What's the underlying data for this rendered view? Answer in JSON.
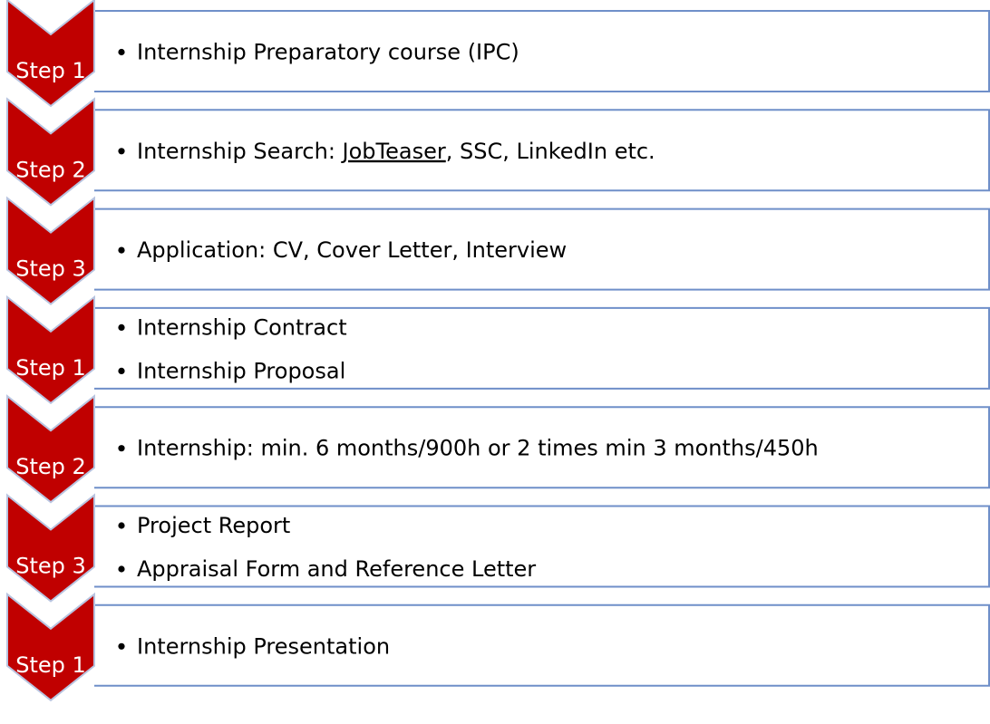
{
  "colors": {
    "chevron_fill": "#c00000",
    "chevron_stroke": "#b8c4e0",
    "box_border": "#6f8fc9",
    "label_text": "#ffffff",
    "body_text": "#000000",
    "spellcheck_underline": "#e02020"
  },
  "steps": [
    {
      "label": "Step 1",
      "bullets": [
        {
          "text": "Internship Preparatory course (IPC)"
        }
      ]
    },
    {
      "label": "Step 2",
      "bullets": [
        {
          "text": "Internship Search: ",
          "underlined": "JobTeaser",
          "after": ", SSC, LinkedIn etc."
        }
      ]
    },
    {
      "label": "Step 3",
      "bullets": [
        {
          "text": "Application: CV, Cover Letter, Interview"
        }
      ]
    },
    {
      "label": "Step 1",
      "bullets": [
        {
          "text": "Internship Contract"
        },
        {
          "text": "Internship Proposal"
        }
      ]
    },
    {
      "label": "Step 2",
      "bullets": [
        {
          "text": "Internship: min. 6 months/900h or 2 times min 3 months/450h"
        }
      ]
    },
    {
      "label": "Step 3",
      "bullets": [
        {
          "text": "Project Report"
        },
        {
          "text": "Appraisal Form and Reference Letter"
        }
      ]
    },
    {
      "label": "Step 1",
      "bullets": [
        {
          "text": "Internship Presentation"
        }
      ]
    }
  ]
}
